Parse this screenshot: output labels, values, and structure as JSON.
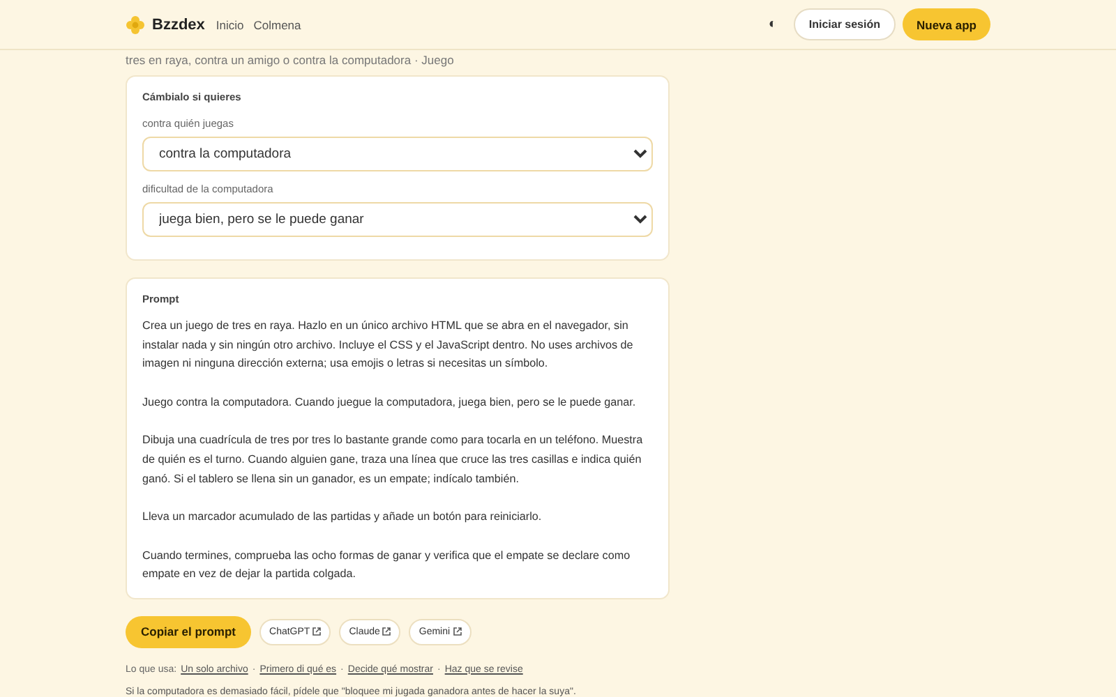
{
  "header": {
    "brand": "Bzzdex",
    "nav": [
      "Inicio",
      "Colmena"
    ],
    "theme_toggle": "◐",
    "login": "Iniciar sesión",
    "new_app": "Nueva app"
  },
  "subtitle": "tres en raya, contra un amigo o contra la computadora · Juego",
  "options": {
    "title": "Cámbialo si quieres",
    "fields": [
      {
        "label": "contra quién juegas",
        "value": "contra la computadora"
      },
      {
        "label": "dificultad de la computadora",
        "value": "juega bien, pero se le puede ganar"
      }
    ]
  },
  "prompt": {
    "title": "Prompt",
    "paragraphs": [
      "Crea un juego de tres en raya. Hazlo en un único archivo HTML que se abra en el navegador, sin instalar nada y sin ningún otro archivo. Incluye el CSS y el JavaScript dentro. No uses archivos de imagen ni ninguna dirección externa; usa emojis o letras si necesitas un símbolo.",
      "Juego contra la computadora. Cuando juegue la computadora, juega bien, pero se le puede ganar.",
      "Dibuja una cuadrícula de tres por tres lo bastante grande como para tocarla en un teléfono. Muestra de quién es el turno. Cuando alguien gane, traza una línea que cruce las tres casillas e indica quién ganó. Si el tablero se llena sin un ganador, es un empate; indícalo también.",
      "Lleva un marcador acumulado de las partidas y añade un botón para reiniciarlo.",
      "Cuando termines, comprueba las ocho formas de ganar y verifica que el empate se declare como empate en vez de dejar la partida colgada."
    ]
  },
  "actions": {
    "copy": "Copiar el prompt",
    "links": [
      "ChatGPT",
      "Claude",
      "Gemini"
    ]
  },
  "uses": {
    "label": "Lo que usa:",
    "links": [
      "Un solo archivo",
      "Primero di qué es",
      "Decide qué mostrar",
      "Haz que se revise"
    ],
    "separator": "·"
  },
  "tip": "Si la computadora es demasiado fácil, pídele que \"bloquee mi jugada ganadora antes de hacer la suya\"."
}
